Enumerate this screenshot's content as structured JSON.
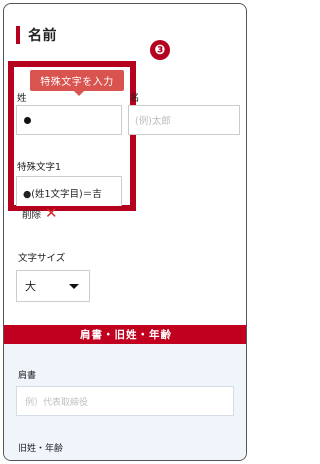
{
  "section": {
    "title": "名前"
  },
  "badge": "❸",
  "tooltip": "特殊文字を入力",
  "fields": {
    "sei_label": "姓",
    "mei_label": "名",
    "mei_placeholder": "(例)太郎",
    "tokushu_label": "特殊文字1",
    "tokushu_value": "●(姓1文字目)＝吉",
    "delete_label": "削除",
    "size_label": "文字サイズ",
    "size_value": "大"
  },
  "band": {
    "title": "肩書・旧姓・年齢"
  },
  "katagaki": {
    "label": "肩書",
    "placeholder": "例）代表取締役"
  },
  "kyusei": {
    "label": "旧姓・年齢"
  },
  "colors": {
    "accent": "#b5001e",
    "tooltip": "#d9534f",
    "panel": "#f0f5fb"
  }
}
